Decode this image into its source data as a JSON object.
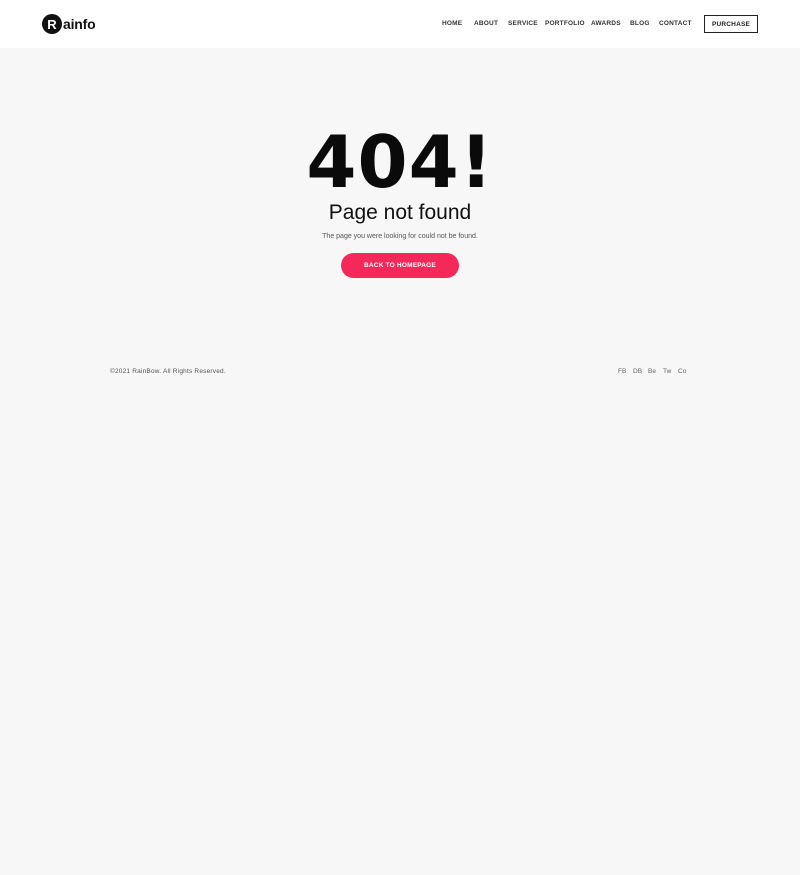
{
  "header": {
    "logo_letter": "R",
    "logo_text": "ainfo",
    "nav": [
      {
        "label": "HOME"
      },
      {
        "label": "ABOUT"
      },
      {
        "label": "SERVICE"
      },
      {
        "label": "PORTFOLIO"
      },
      {
        "label": "AWARDS"
      },
      {
        "label": "BLOG"
      },
      {
        "label": "CONTACT"
      }
    ],
    "purchase_label": "PURCHASE"
  },
  "error": {
    "code": "404!",
    "title": "Page not found",
    "message": "The page you were looking for could not be found.",
    "button_label": "BACK TO HOMEPAGE",
    "accent_color": "#f5285a"
  },
  "footer": {
    "copyright": "©2021 RainBow. All Rights Reserved.",
    "social": [
      {
        "label": "FB"
      },
      {
        "label": "DB"
      },
      {
        "label": "Be"
      },
      {
        "label": "Tw"
      },
      {
        "label": "Co"
      }
    ]
  }
}
